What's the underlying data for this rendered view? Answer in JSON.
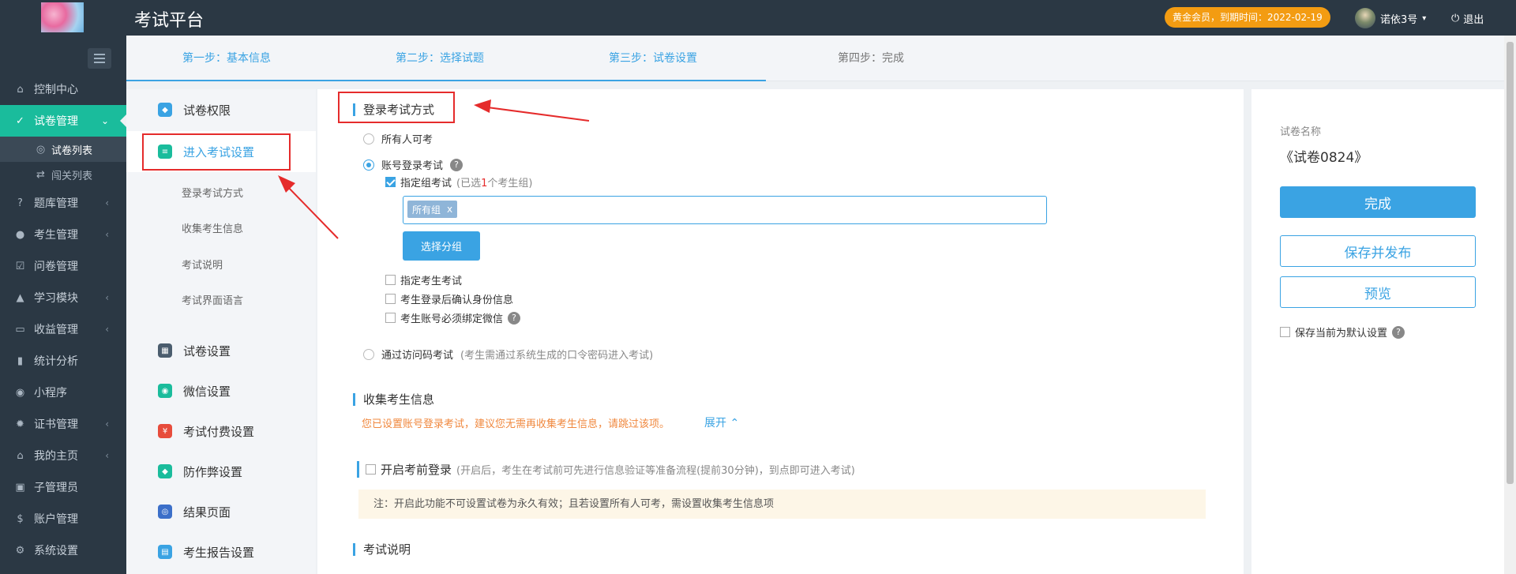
{
  "header": {
    "brand": "考试平台",
    "vip_badge": "黄金会员，到期时间：2022-02-19",
    "username": "诺依3号",
    "logout": "退出"
  },
  "sidebar": {
    "items": [
      {
        "label": "控制中心",
        "icon": "home-icon"
      },
      {
        "label": "试卷管理",
        "icon": "check-circle-icon",
        "active": true
      },
      {
        "label": "题库管理",
        "icon": "question-icon"
      },
      {
        "label": "考生管理",
        "icon": "user-icon"
      },
      {
        "label": "问卷管理",
        "icon": "checkbox-icon"
      },
      {
        "label": "学习模块",
        "icon": "graduation-icon"
      },
      {
        "label": "收益管理",
        "icon": "money-icon"
      },
      {
        "label": "统计分析",
        "icon": "chart-icon"
      },
      {
        "label": "小程序",
        "icon": "wechat-icon"
      },
      {
        "label": "证书管理",
        "icon": "badge-icon"
      },
      {
        "label": "我的主页",
        "icon": "home2-icon"
      },
      {
        "label": "子管理员",
        "icon": "lock-icon"
      },
      {
        "label": "账户管理",
        "icon": "dollar-icon"
      },
      {
        "label": "系统设置",
        "icon": "gear-icon"
      }
    ],
    "subitems": [
      {
        "label": "试卷列表",
        "icon": "check-circle-icon"
      },
      {
        "label": "闯关列表",
        "icon": "shuffle-icon"
      }
    ]
  },
  "steps": [
    "第一步：基本信息",
    "第二步：选择试题",
    "第三步：试卷设置",
    "第四步：完成"
  ],
  "left_menu": {
    "items": [
      {
        "label": "试卷权限",
        "color": "#3aa3e3"
      },
      {
        "label": "进入考试设置",
        "color": "#1abc9c"
      },
      {
        "label": "试卷设置",
        "color": "#4b5d6e"
      },
      {
        "label": "微信设置",
        "color": "#1abc9c"
      },
      {
        "label": "考试付费设置",
        "color": "#e74c3c"
      },
      {
        "label": "防作弊设置",
        "color": "#1abc9c"
      },
      {
        "label": "结果页面",
        "color": "#3b6fc9"
      },
      {
        "label": "考生报告设置",
        "color": "#3aa3e3"
      }
    ],
    "subs": [
      "登录考试方式",
      "收集考生信息",
      "考试说明",
      "考试界面语言"
    ]
  },
  "main": {
    "login_title": "登录考试方式",
    "opt_all": "所有人可考",
    "opt_account": "账号登录考试",
    "group_check": "指定组考试",
    "group_hint_pre": "(已选",
    "group_hint_count": "1",
    "group_hint_post": "个考生组)",
    "tag_label": "所有组",
    "tag_close": "x",
    "select_group_btn": "选择分组",
    "check_student": "指定考生考试",
    "check_confirm": "考生登录后确认身份信息",
    "check_wechat": "考生账号必须绑定微信",
    "opt_code": "通过访问码考试",
    "opt_code_hint": "(考生需通过系统生成的口令密码进入考试)",
    "collect_title": "收集考生信息",
    "collect_warn": "您已设置账号登录考试，建议您无需再收集考生信息，请跳过该项。",
    "expand": "展开",
    "prelogin_label": "开启考前登录",
    "prelogin_hint": "(开启后，考生在考试前可先进行信息验证等准备流程(提前30分钟)，到点即可进入考试)",
    "notice": "注：开启此功能不可设置试卷为永久有效；且若设置所有人可考，需设置收集考生信息项",
    "explain_title": "考试说明"
  },
  "right": {
    "name_label": "试卷名称",
    "name_value": "《试卷0824》",
    "finish_btn": "完成",
    "publish_btn": "保存并发布",
    "preview_btn": "预览",
    "default_check": "保存当前为默认设置"
  },
  "colors": {
    "accent": "#3aa3e3",
    "active_nav": "#1abc9c",
    "vip": "#f39c12",
    "annotation": "#e52b2b"
  }
}
